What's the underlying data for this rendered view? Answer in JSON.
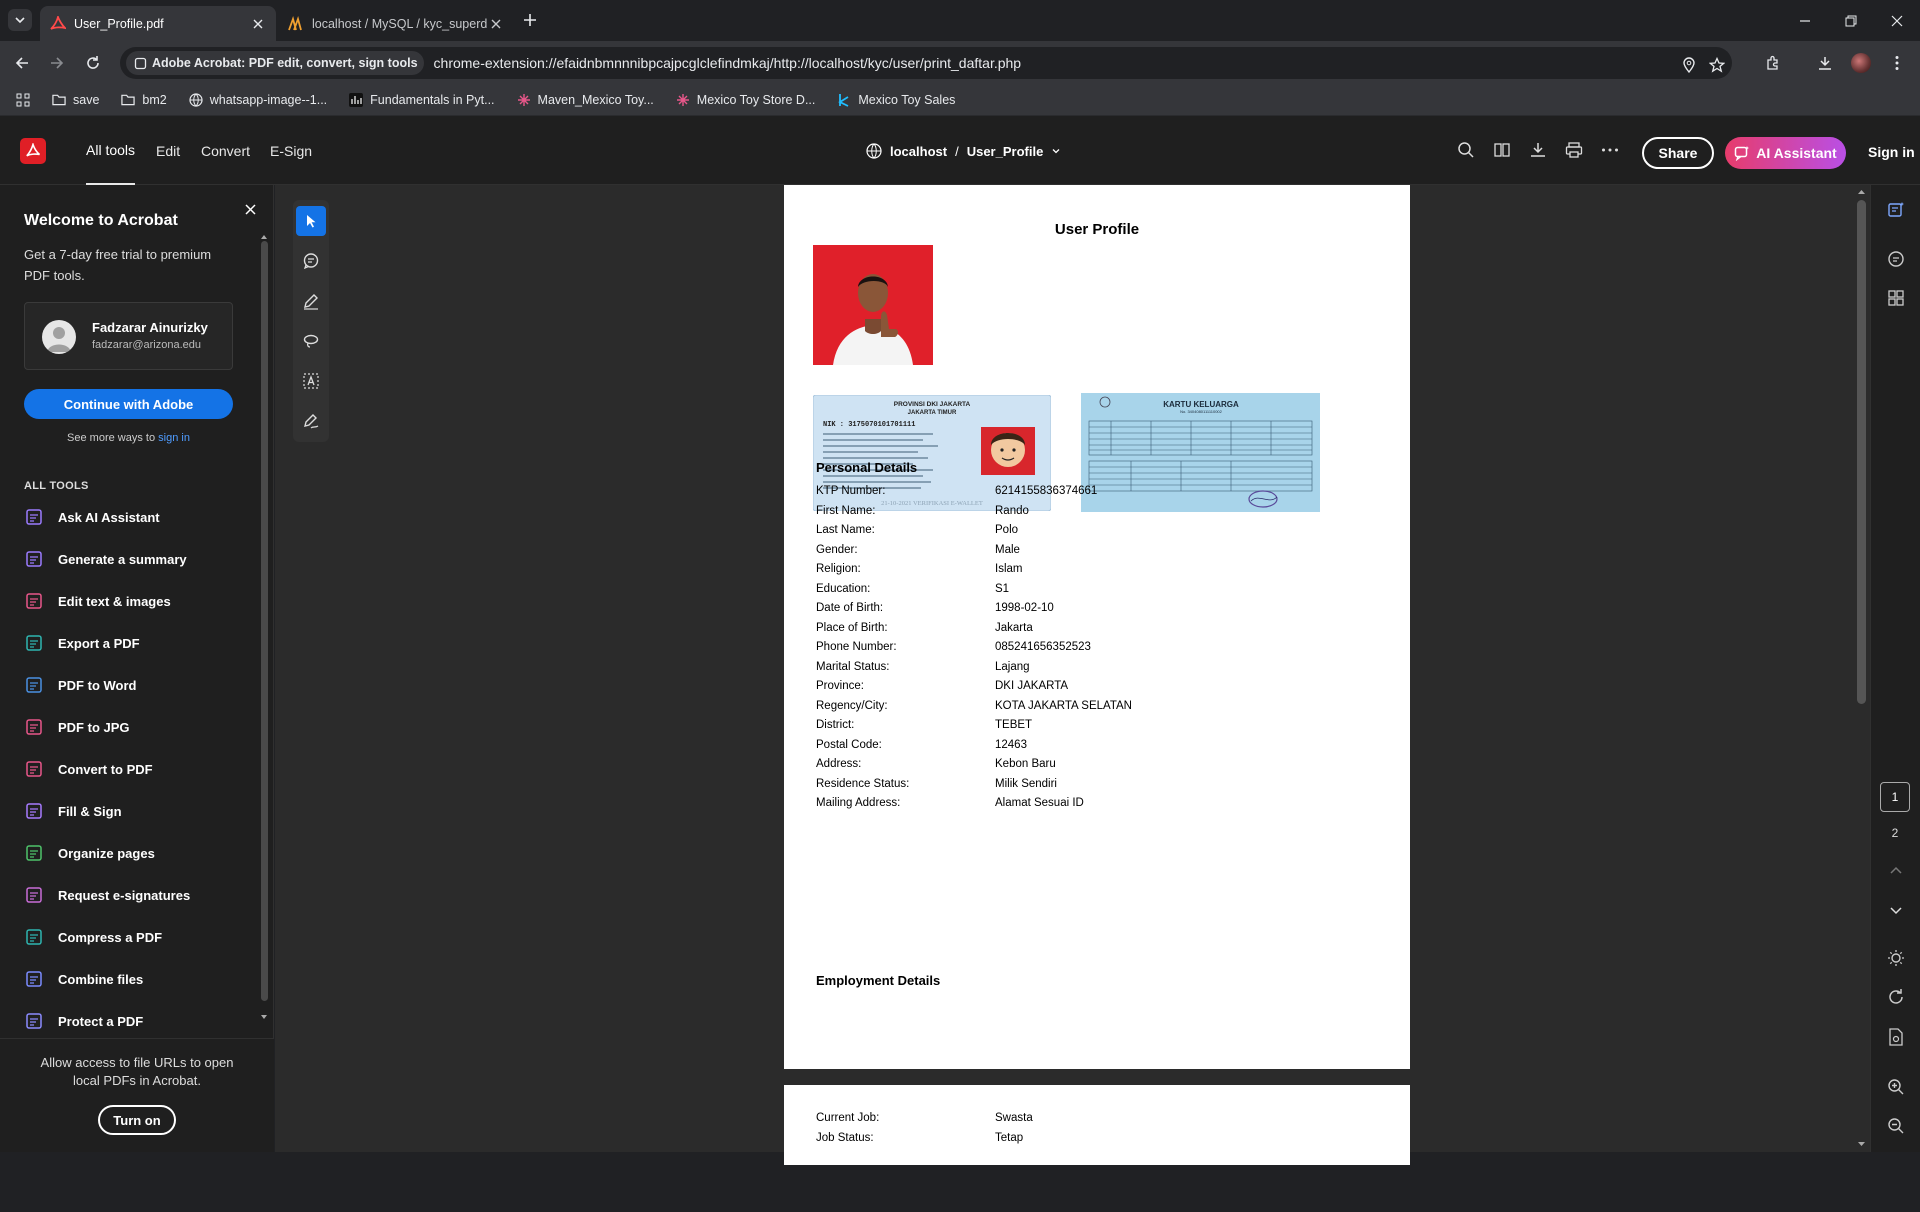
{
  "browser": {
    "tabs": [
      {
        "title": "User_Profile.pdf",
        "active": true
      },
      {
        "title": "localhost / MySQL / kyc_superd",
        "active": false
      }
    ],
    "site_chip": "Adobe Acrobat: PDF edit, convert, sign tools",
    "url": "chrome-extension://efaidnbmnnnibpcajpcglclefindmkaj/http://localhost/kyc/user/print_daftar.php",
    "bookmarks": [
      {
        "label": "save",
        "icon": "folder-icon"
      },
      {
        "label": "bm2",
        "icon": "folder-icon"
      },
      {
        "label": "whatsapp-image--1...",
        "icon": "globe-icon"
      },
      {
        "label": "Fundamentals in Pyt...",
        "icon": "course-icon"
      },
      {
        "label": "Maven_Mexico Toy...",
        "icon": "tableau-icon"
      },
      {
        "label": "Mexico Toy Store D...",
        "icon": "tableau-icon"
      },
      {
        "label": "Mexico Toy Sales",
        "icon": "k-icon"
      }
    ]
  },
  "acrobat": {
    "menu": [
      "All tools",
      "Edit",
      "Convert",
      "E-Sign"
    ],
    "breadcrumb": {
      "host": "localhost",
      "separator": "/",
      "file": "User_Profile"
    },
    "share_label": "Share",
    "ai_label": "AI Assistant",
    "signin_label": "Sign in",
    "accent_color": "#1473e6"
  },
  "panel": {
    "title": "Welcome to Acrobat",
    "subtitle": "Get a 7-day free trial to premium PDF tools.",
    "user_name": "Fadzarar Ainurizky",
    "user_email": "fadzarar@arizona.edu",
    "continue_label": "Continue with Adobe",
    "more_ways_text": "See more ways to",
    "more_ways_link": "sign in",
    "all_tools_heading": "ALL TOOLS",
    "tools": [
      {
        "label": "Ask AI Assistant",
        "icon": "ai-assistant-icon",
        "color": "#9b7bff"
      },
      {
        "label": "Generate a summary",
        "icon": "summary-icon",
        "color": "#9b7bff"
      },
      {
        "label": "Edit text & images",
        "icon": "edit-text-icon",
        "color": "#e8578a"
      },
      {
        "label": "Export a PDF",
        "icon": "export-pdf-icon",
        "color": "#2fb5b0"
      },
      {
        "label": "PDF to Word",
        "icon": "pdf-to-word-icon",
        "color": "#4a90e2"
      },
      {
        "label": "PDF to JPG",
        "icon": "pdf-to-jpg-icon",
        "color": "#e8578a"
      },
      {
        "label": "Convert to PDF",
        "icon": "convert-to-pdf-icon",
        "color": "#e8578a"
      },
      {
        "label": "Fill & Sign",
        "icon": "fill-sign-icon",
        "color": "#a77bff"
      },
      {
        "label": "Organize pages",
        "icon": "organize-pages-icon",
        "color": "#4ec36a"
      },
      {
        "label": "Request e-signatures",
        "icon": "request-signatures-icon",
        "color": "#c86dd7"
      },
      {
        "label": "Compress a PDF",
        "icon": "compress-pdf-icon",
        "color": "#2fb5b0"
      },
      {
        "label": "Combine files",
        "icon": "combine-files-icon",
        "color": "#7b8cff"
      },
      {
        "label": "Protect a PDF",
        "icon": "protect-pdf-icon",
        "color": "#8b8bff"
      }
    ],
    "footer_text": "Allow access to file URLs to open local PDFs in Acrobat.",
    "turn_on_label": "Turn on"
  },
  "document": {
    "title": "User Profile",
    "personal_heading": "Personal Details",
    "personal": [
      {
        "label": "KTP Number:",
        "value": "6214155836374661"
      },
      {
        "label": "First Name:",
        "value": "Rando"
      },
      {
        "label": "Last Name:",
        "value": "Polo"
      },
      {
        "label": "Gender:",
        "value": "Male"
      },
      {
        "label": "Religion:",
        "value": "Islam"
      },
      {
        "label": "Education:",
        "value": "S1"
      },
      {
        "label": "Date of Birth:",
        "value": "1998-02-10"
      },
      {
        "label": "Place of Birth:",
        "value": "Jakarta"
      },
      {
        "label": "Phone Number:",
        "value": "085241656352523"
      },
      {
        "label": "Marital Status:",
        "value": "Lajang"
      },
      {
        "label": "Province:",
        "value": "DKI JAKARTA"
      },
      {
        "label": "Regency/City:",
        "value": "KOTA JAKARTA SELATAN"
      },
      {
        "label": "District:",
        "value": "TEBET"
      },
      {
        "label": "Postal Code:",
        "value": "12463"
      },
      {
        "label": "Address:",
        "value": "Kebon Baru"
      },
      {
        "label": "Residence Status:",
        "value": "Milik Sendiri"
      },
      {
        "label": "Mailing Address:",
        "value": "Alamat Sesuai ID"
      }
    ],
    "employment_heading": "Employment Details",
    "employment": [
      {
        "label": "Current Job:",
        "value": "Swasta"
      },
      {
        "label": "Job Status:",
        "value": "Tetap"
      }
    ],
    "ktp_card": {
      "province": "PROVINSI DKI JAKARTA",
      "city": "JAKARTA TIMUR",
      "nik": "NIK : 3175070101701111",
      "footer": "21-10-2021 VERIFIKASI E-WALLET"
    },
    "kk_card": {
      "title": "KARTU KELUARGA",
      "number": "No. 3404080111110002"
    }
  },
  "pages": {
    "current": "1",
    "next": "2"
  }
}
